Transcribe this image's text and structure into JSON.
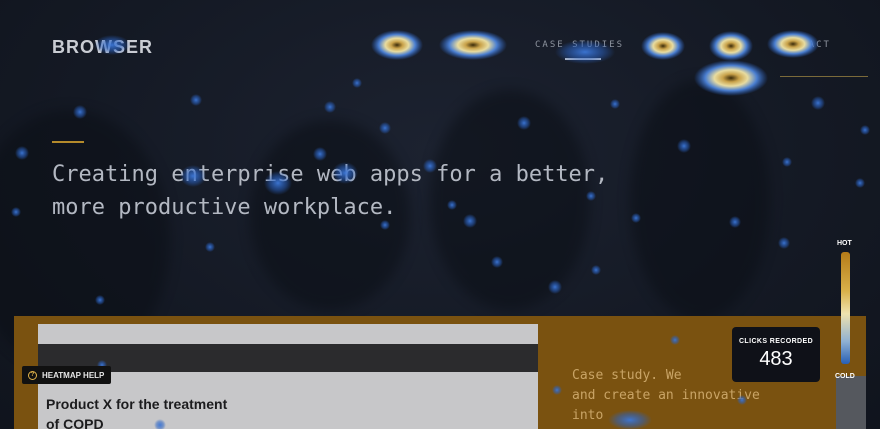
{
  "site": {
    "logo": "BROWSER",
    "nav": {
      "case_studies": "CASE STUDIES",
      "contact": "CONTACT"
    },
    "hero_lines": [
      "Creating enterprise web apps for a better,",
      "more productive workplace."
    ]
  },
  "case_card": {
    "title_lines": [
      "Product X for the treatment",
      "of COPD"
    ]
  },
  "case_text_lines": [
    "Case study. We",
    "and create an innovative",
    "into"
  ],
  "heatmap": {
    "help_label": "HEATMAP HELP",
    "clicks_label": "CLICKS RECORDED",
    "clicks_value": "483",
    "legend_hot": "HOT",
    "legend_cold": "COLD"
  },
  "colors": {
    "accent": "#b48a2b",
    "heat_hot": "#c9a24a",
    "heat_warm": "#d9c46b",
    "heat_cold": "#2b63c4"
  },
  "icons": {
    "help": "help-circle-icon"
  }
}
